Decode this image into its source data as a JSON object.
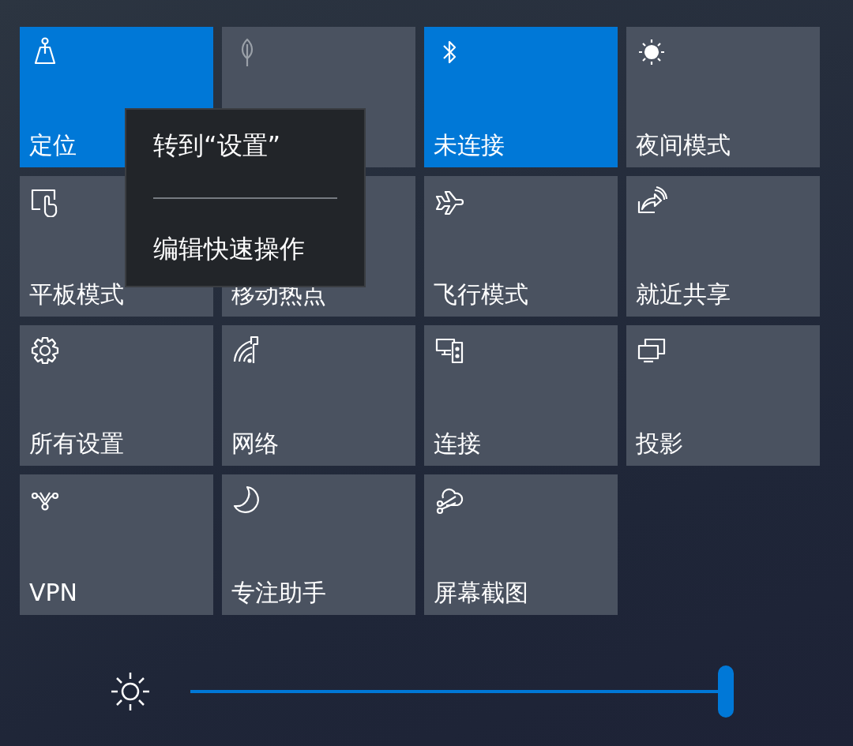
{
  "tiles": [
    {
      "label": "定位",
      "kind": "location",
      "on": true,
      "disabled": false
    },
    {
      "kind": "leaf",
      "on": false,
      "disabled": true
    },
    {
      "label": "未连接",
      "kind": "bluetooth",
      "on": true,
      "disabled": false
    },
    {
      "label": "夜间模式",
      "kind": "night",
      "on": false,
      "disabled": false
    },
    {
      "label": "平板模式",
      "kind": "tablet",
      "on": false,
      "disabled": false
    },
    {
      "label": "移动热点",
      "on": false,
      "disabled": false
    },
    {
      "label": "飞行模式",
      "kind": "airplane",
      "on": false,
      "disabled": false
    },
    {
      "label": "就近共享",
      "kind": "share",
      "on": false,
      "disabled": false
    },
    {
      "label": "所有设置",
      "kind": "settings",
      "on": false,
      "disabled": false
    },
    {
      "label": "网络",
      "kind": "network",
      "on": false,
      "disabled": false
    },
    {
      "label": "连接",
      "kind": "connect",
      "on": false,
      "disabled": false
    },
    {
      "label": "投影",
      "kind": "project",
      "on": false,
      "disabled": false
    },
    {
      "label": "VPN",
      "kind": "vpn",
      "on": false,
      "disabled": false
    },
    {
      "label": "专注助手",
      "kind": "moon",
      "on": false,
      "disabled": false
    },
    {
      "label": "屏幕截图",
      "kind": "snip",
      "on": false,
      "disabled": false
    }
  ],
  "context_menu": {
    "items": [
      "转到“设置”",
      "编辑快速操作"
    ]
  },
  "brightness": {
    "level": 1
  }
}
